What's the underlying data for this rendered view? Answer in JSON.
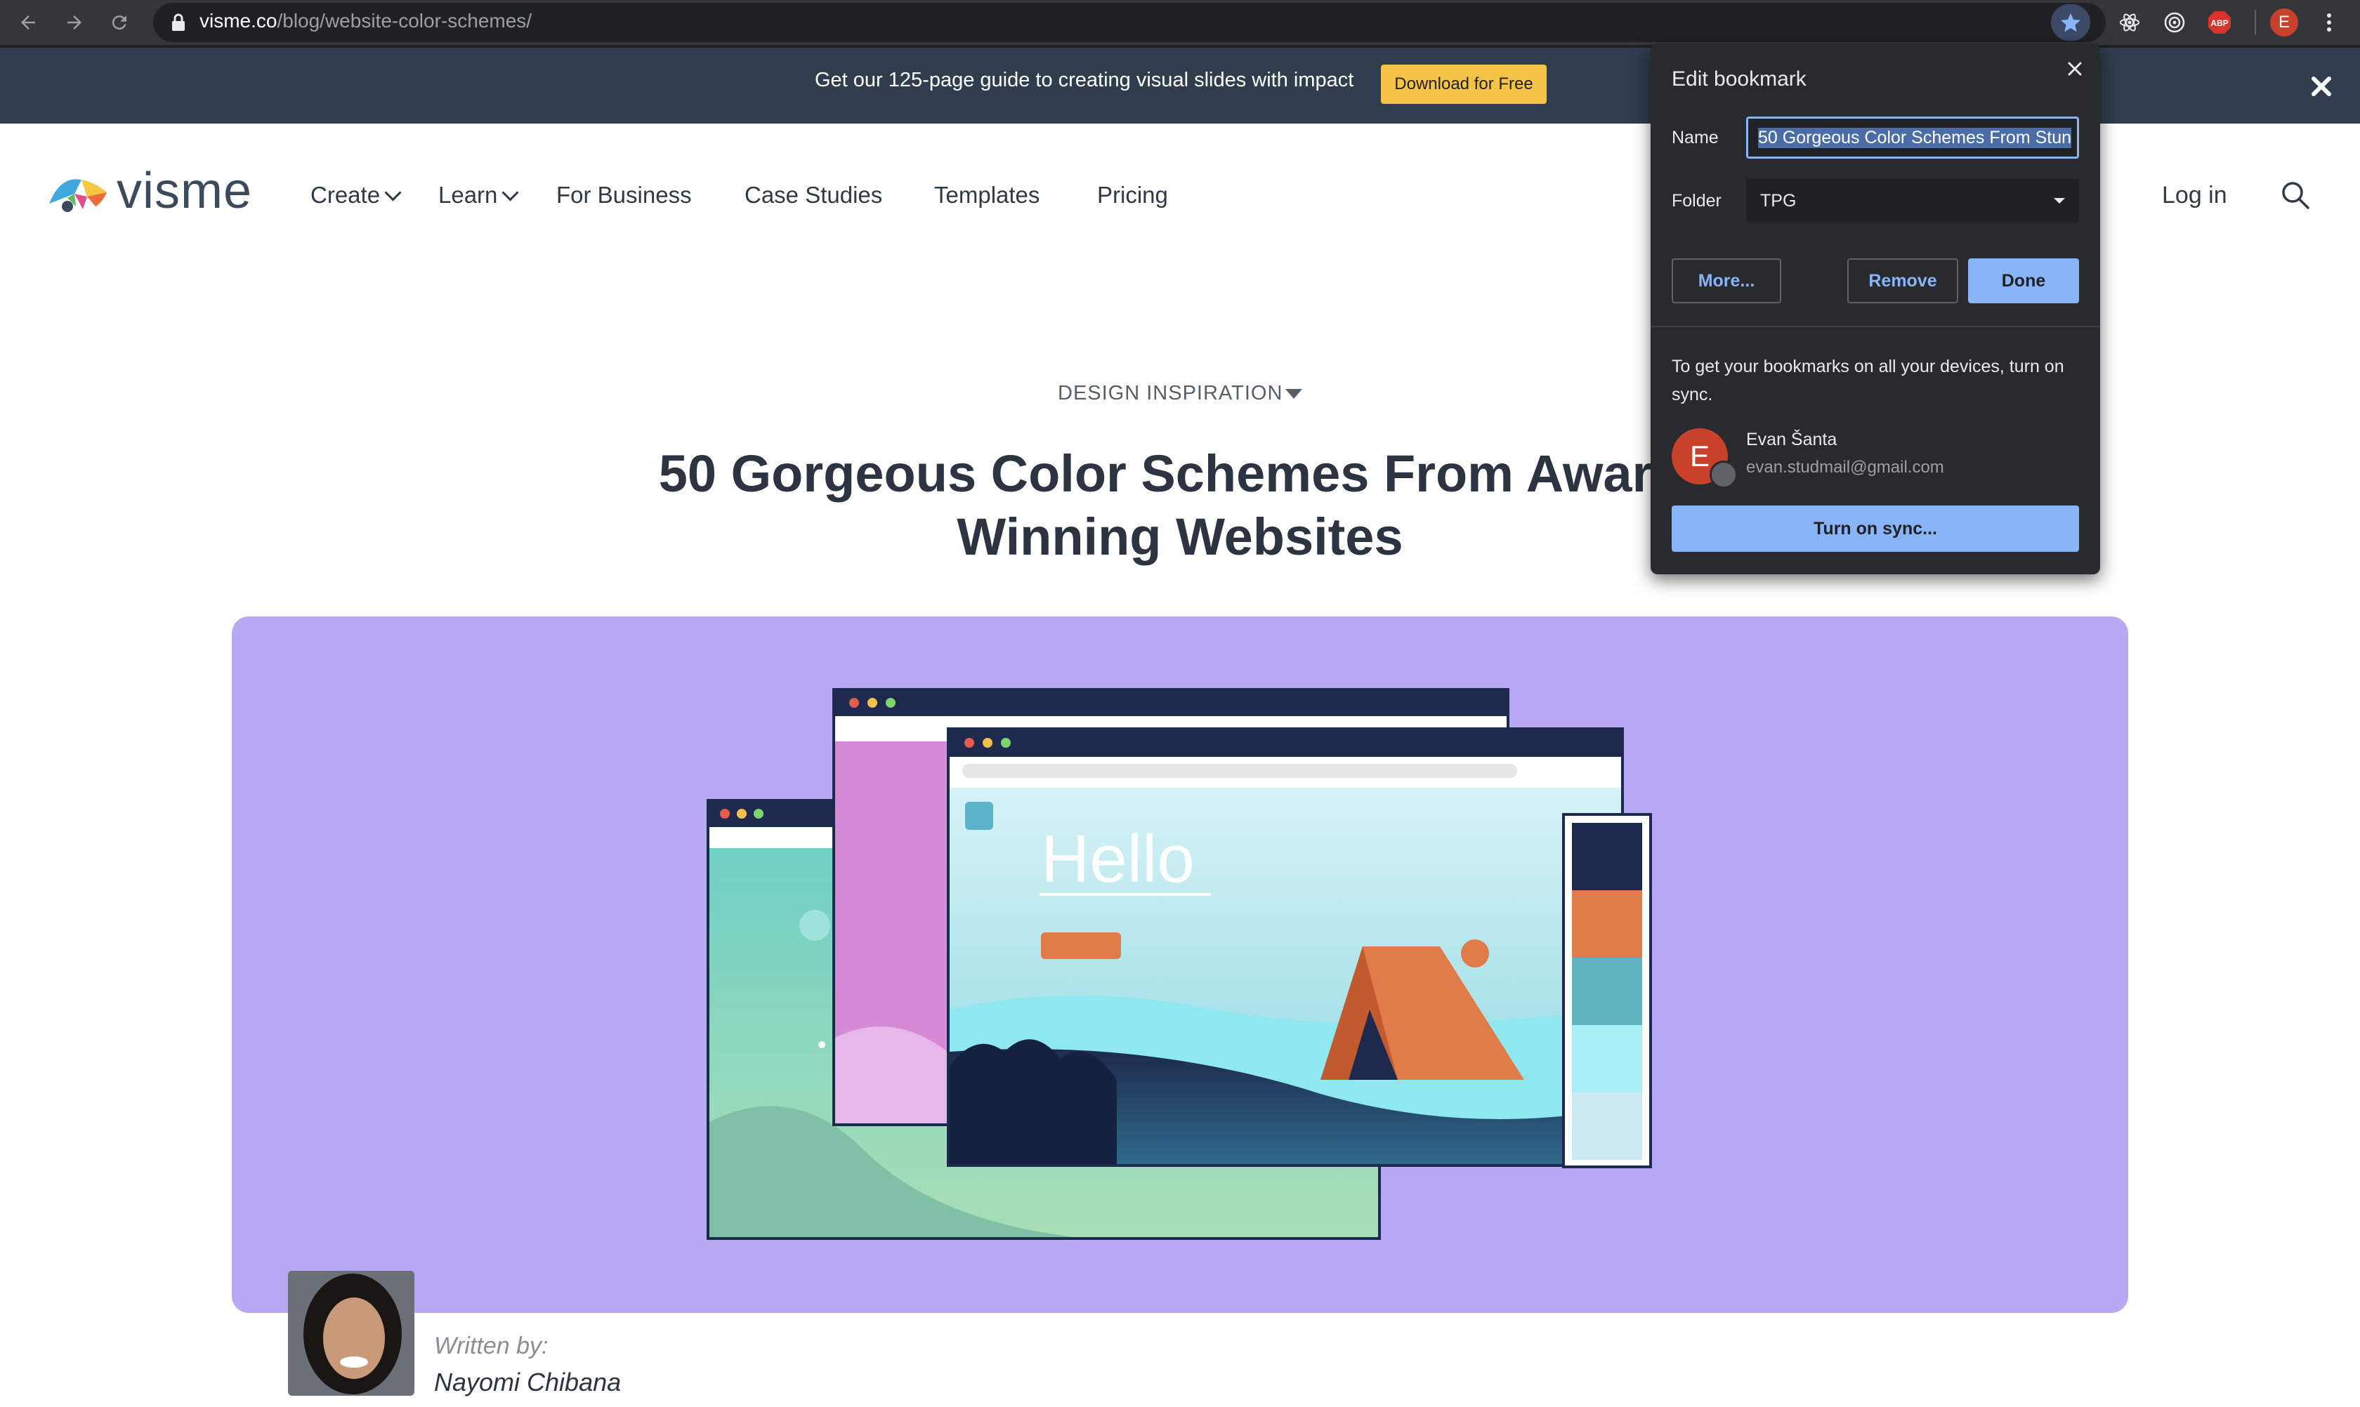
{
  "browser": {
    "url_host": "visme.co",
    "url_path": "/blog/website-color-schemes/",
    "avatar_letter": "E",
    "abp_label": "ABP",
    "colors": {
      "toolbar": "#35363a",
      "omnibox": "#202124"
    }
  },
  "promo": {
    "text": "Get our 125-page guide to creating visual slides with impact",
    "button_label": "Download for Free",
    "colors": {
      "bar": "#2f3d4d",
      "button": "#f5c446"
    }
  },
  "header": {
    "logo_text": "visme",
    "nav": [
      {
        "label": "Create",
        "has_dropdown": true
      },
      {
        "label": "Learn",
        "has_dropdown": true
      },
      {
        "label": "For Business",
        "has_dropdown": false
      },
      {
        "label": "Case Studies",
        "has_dropdown": false
      },
      {
        "label": "Templates",
        "has_dropdown": false
      },
      {
        "label": "Pricing",
        "has_dropdown": false
      }
    ],
    "login_label": "Log in"
  },
  "article": {
    "category": "DESIGN INSPIRATION",
    "title_line1": "50 Gorgeous Color Schemes From Award-",
    "title_line2": "Winning Websites",
    "hero": {
      "hello_text": "Hello",
      "swatches": [
        "#1d2a4d",
        "#e07b4a",
        "#5fb3c1",
        "#a8f0f5",
        "#cde9f2"
      ],
      "bg_color": "#b8a9f4"
    },
    "author": {
      "written_by": "Written by:",
      "name": "Nayomi Chibana"
    }
  },
  "bookmark_popup": {
    "title": "Edit bookmark",
    "name_label": "Name",
    "name_value": "50 Gorgeous Color Schemes From Stun",
    "folder_label": "Folder",
    "folder_value": "TPG",
    "more_label": "More...",
    "remove_label": "Remove",
    "done_label": "Done",
    "sync_text": "To get your bookmarks on all your devices, turn on sync.",
    "user_initial": "E",
    "user_name": "Evan Šanta",
    "user_email": "evan.studmail@gmail.com",
    "sync_button_label": "Turn on sync...",
    "colors": {
      "bg": "#292a2d",
      "accent": "#8ab4f8",
      "avatar": "#c8412b"
    }
  }
}
